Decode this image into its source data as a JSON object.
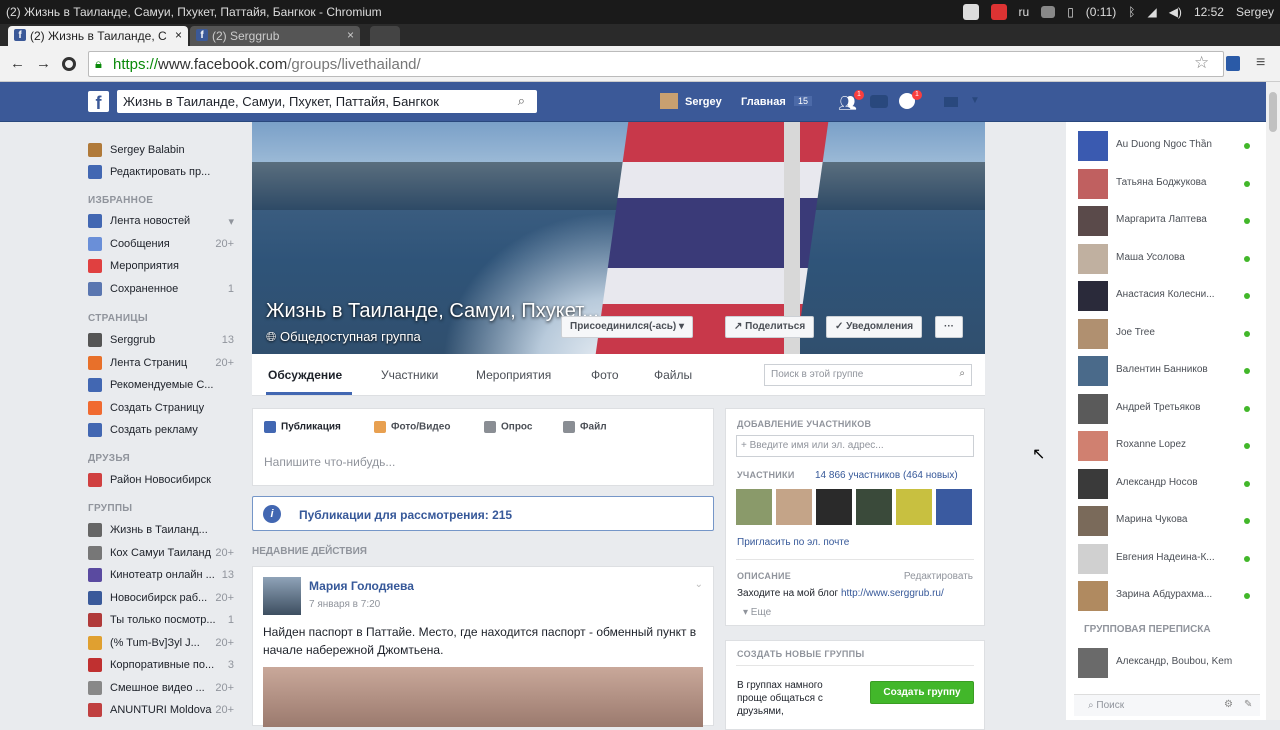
{
  "window": {
    "title": "(2) Жизнь в Таиланде, Самуи, Пхукет, Паттайя, Бангкок - Chromium",
    "lang": "ru",
    "battery": "(0:11)",
    "time": "12:52",
    "user": "Sergey"
  },
  "tabs": [
    {
      "label": "(2) Жизнь в Таиланде, С",
      "close": "×"
    },
    {
      "label": "(2) Serggrub",
      "close": "×"
    }
  ],
  "browser": {
    "url_https": "https://",
    "url_host": "www.facebook.com",
    "url_path": "/groups/livethailand/",
    "back": "←",
    "forward": "→",
    "star": "☆",
    "menu": "≡"
  },
  "fb": {
    "logo": "f",
    "search_value": "Жизнь в Таиланде, Самуи, Пхукет, Паттайя, Бангкок",
    "user": "Sergey",
    "home": "Главная",
    "home_count": "15",
    "friends_badge": "1",
    "globe_badge": "1"
  },
  "left": {
    "profile": [
      {
        "label": "Sergey Balabin",
        "color": "#b07a3a"
      },
      {
        "label": "Редактировать пр...",
        "color": "#4267b2"
      }
    ],
    "favorites_header": "ИЗБРАННОЕ",
    "favorites": [
      {
        "label": "Лента новостей",
        "count": "▾",
        "color": "#4267b2"
      },
      {
        "label": "Сообщения",
        "count": "20+",
        "color": "#6a8fd8"
      },
      {
        "label": "Мероприятия",
        "count": "",
        "color": "#e04040"
      },
      {
        "label": "Сохраненное",
        "count": "1",
        "color": "#5a76b0"
      }
    ],
    "pages_header": "СТРАНИЦЫ",
    "pages": [
      {
        "label": "Serggrub",
        "count": "13",
        "color": "#555"
      },
      {
        "label": "Лента Страниц",
        "count": "20+",
        "color": "#e8702a"
      },
      {
        "label": "Рекомендуемые С...",
        "count": "",
        "color": "#4267b2"
      },
      {
        "label": "Создать Страницу",
        "count": "",
        "color": "#f06a30"
      },
      {
        "label": "Создать рекламу",
        "count": "",
        "color": "#4267b2"
      }
    ],
    "friends_header": "ДРУЗЬЯ",
    "friends": [
      {
        "label": "Район Новосибирск",
        "count": "",
        "color": "#d04040"
      }
    ],
    "groups_header": "ГРУППЫ",
    "groups": [
      {
        "label": "Жизнь в Таиланд...",
        "count": "",
        "color": "#666"
      },
      {
        "label": "Кох Самуи Таиланд",
        "count": "20+",
        "color": "#777"
      },
      {
        "label": "Кинотеатр онлайн ...",
        "count": "13",
        "color": "#5a4aa0"
      },
      {
        "label": "Новосибирск раб...",
        "count": "20+",
        "color": "#3a5a9a"
      },
      {
        "label": "Ты только посмотр...",
        "count": "1",
        "color": "#b03a3a"
      },
      {
        "label": "(% Tum-Bv]Зуl J...",
        "count": "20+",
        "color": "#e0a030"
      },
      {
        "label": "Корпоративные по...",
        "count": "3",
        "color": "#c03030"
      },
      {
        "label": "Смешное видео ...",
        "count": "20+",
        "color": "#888"
      },
      {
        "label": "ANUNTURI Moldova",
        "count": "20+",
        "color": "#c04040"
      }
    ]
  },
  "cover": {
    "group_name": "Жизнь в Таиланде, Самуи, Пхукет...",
    "group_type": "Общедоступная группа",
    "joined": "Присоединился(-ась) ▾",
    "share": "Поделиться",
    "notifications": "Уведомления",
    "more": "···"
  },
  "group_tabs": [
    "Обсуждение",
    "Участники",
    "Мероприятия",
    "Фото",
    "Файлы"
  ],
  "group_search_placeholder": "Поиск в этой группе",
  "composer": {
    "actions": [
      "Публикация",
      "Фото/Видео",
      "Опрос",
      "Файл"
    ],
    "placeholder": "Напишите что-нибудь..."
  },
  "pending": {
    "icon": "i",
    "text": "Публикации для рассмотрения: 215"
  },
  "recent_header": "НЕДАВНИЕ ДЕЙСТВИЯ",
  "post": {
    "author": "Мария Голодяева",
    "date": "7 января в 7:20",
    "text": "Найден паспорт в Паттайе. Место, где находится паспорт - обменный пункт в начале набережной Джомтьена."
  },
  "add_members": {
    "header": "ДОБАВЛЕНИЕ УЧАСТНИКОВ",
    "placeholder": "+ Введите имя или эл. адрес..."
  },
  "members": {
    "header": "УЧАСТНИКИ",
    "count": "14 866 участников (464 новых)",
    "invite": "Пригласить по эл. почте",
    "colors": [
      "#8a9a6a",
      "#c4a488",
      "#2a2a2a",
      "#3a4a3a",
      "#c8c040",
      "#3a5aa0"
    ]
  },
  "description": {
    "header": "ОПИСАНИЕ",
    "edit": "Редактировать",
    "text": "Заходите на мой блог",
    "link": "http://www.serggrub.ru/",
    "more": "▾ Еще"
  },
  "create_group": {
    "header": "СОЗДАТЬ НОВЫЕ ГРУППЫ",
    "text": "В группах намного проще общаться с друзьями,",
    "button": "Создать группу"
  },
  "chat": {
    "contacts": [
      {
        "name": "Au Duong Ngoc Thần",
        "color": "#3a5ab0"
      },
      {
        "name": "Татьяна Боджукова",
        "color": "#c06060"
      },
      {
        "name": "Маргарита Лаптева",
        "color": "#5a4a4a"
      },
      {
        "name": "Маша Усолова",
        "color": "#c0b0a0"
      },
      {
        "name": "Анастасия Колесни...",
        "color": "#2a2a3a"
      },
      {
        "name": "Joe Tree",
        "color": "#b09070"
      },
      {
        "name": "Валентин Банников",
        "color": "#4a6a8a"
      },
      {
        "name": "Андрей Третьяков",
        "color": "#5a5a5a"
      },
      {
        "name": "Roxanne Lopez",
        "color": "#d08070"
      },
      {
        "name": "Александр Носов",
        "color": "#3a3a3a"
      },
      {
        "name": "Марина Чукова",
        "color": "#7a6a5a"
      },
      {
        "name": "Евгения Надеина-К...",
        "color": "#d0d0d0"
      },
      {
        "name": "Зарина Абдурахма...",
        "color": "#b08a60"
      }
    ],
    "group_header": "ГРУППОВАЯ ПЕРЕПИСКА",
    "group_chat": {
      "name": "Александр, Boubou, Kem",
      "color": "#6a6a6a"
    },
    "search": "Поиск"
  }
}
